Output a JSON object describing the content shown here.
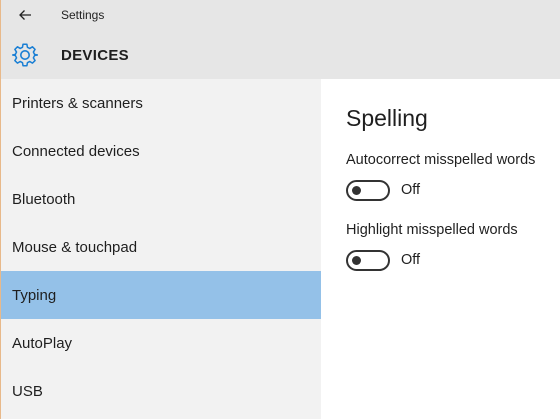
{
  "titlebar": {
    "title": "Settings",
    "back_icon": "back-arrow-icon"
  },
  "header": {
    "icon": "gear-icon",
    "title": "DEVICES",
    "accent_color": "#1a7fd4"
  },
  "sidebar": {
    "selected_color": "#94c1e8",
    "items": [
      {
        "label": "Printers & scanners",
        "selected": false
      },
      {
        "label": "Connected devices",
        "selected": false
      },
      {
        "label": "Bluetooth",
        "selected": false
      },
      {
        "label": "Mouse & touchpad",
        "selected": false
      },
      {
        "label": "Typing",
        "selected": true
      },
      {
        "label": "AutoPlay",
        "selected": false
      },
      {
        "label": "USB",
        "selected": false
      }
    ]
  },
  "content": {
    "title": "Spelling",
    "settings": [
      {
        "label": "Autocorrect misspelled words",
        "state": "Off"
      },
      {
        "label": "Highlight misspelled words",
        "state": "Off"
      }
    ]
  }
}
